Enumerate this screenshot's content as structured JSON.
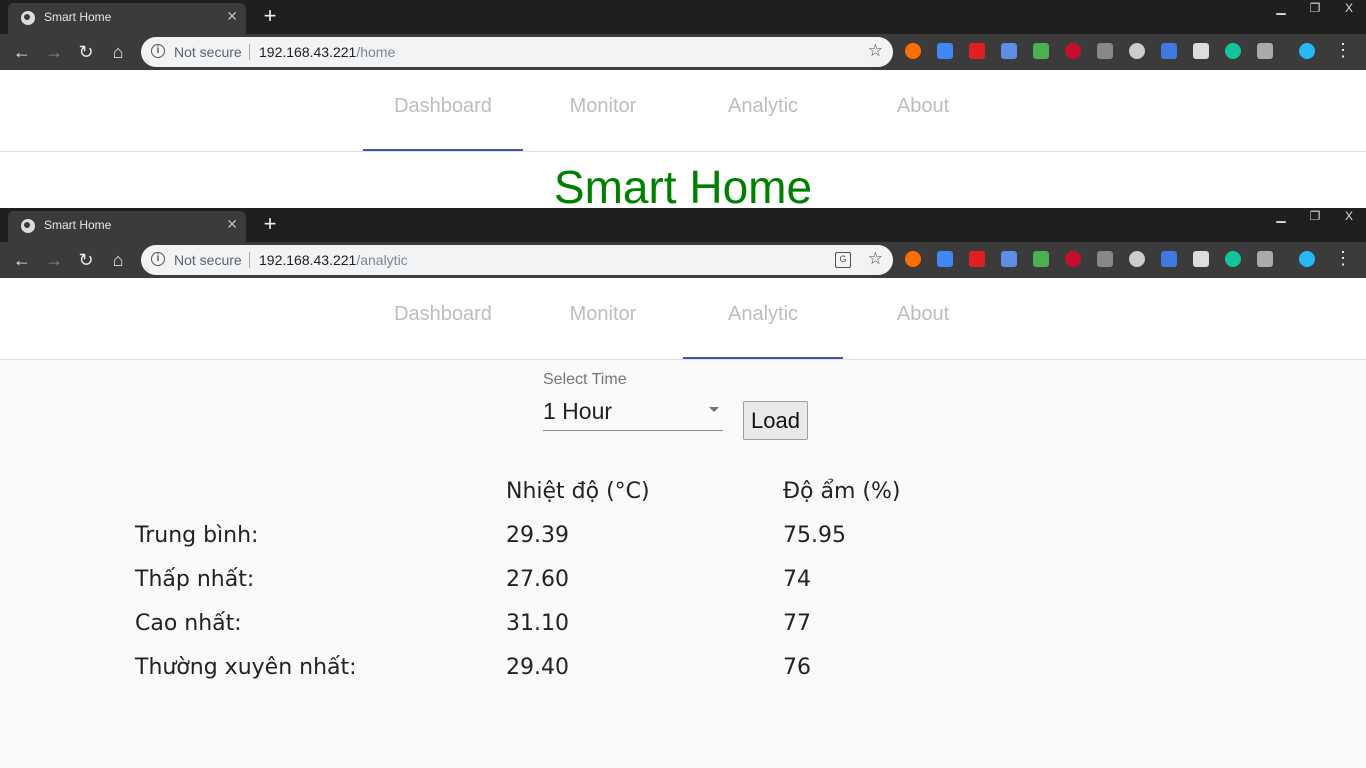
{
  "browser": {
    "close_glyph": "✕",
    "new_tab_glyph": "+",
    "minimize_glyph": "▁",
    "restore_glyph": "❐",
    "window_close_glyph": "X",
    "back_glyph": "←",
    "forward_glyph": "→",
    "reload_glyph": "↻",
    "home_glyph": "⌂",
    "star_glyph": "☆",
    "menu_glyph": "⋮",
    "info_glyph": "i",
    "not_secure": "Not secure"
  },
  "window1": {
    "tab_title": "Smart Home",
    "url_host": "192.168.43.221",
    "url_path": "/home",
    "page_title": "Smart Home"
  },
  "window2": {
    "tab_title": "Smart Home",
    "url_host": "192.168.43.221",
    "url_path": "/analytic"
  },
  "nav": {
    "tabs": [
      {
        "label": "Dashboard"
      },
      {
        "label": "Monitor"
      },
      {
        "label": "Analytic"
      },
      {
        "label": "About"
      }
    ]
  },
  "analytic": {
    "select_label": "Select Time",
    "select_value": "1 Hour",
    "load_button": "Load",
    "columns": [
      "Nhiệt độ (°C)",
      "Độ ẩm (%)"
    ],
    "rows": [
      {
        "label": "Trung bình:",
        "temp": "29.39",
        "humidity": "75.95"
      },
      {
        "label": "Thấp nhất:",
        "temp": "27.60",
        "humidity": "74"
      },
      {
        "label": "Cao nhất:",
        "temp": "31.10",
        "humidity": "77"
      },
      {
        "label": "Thường xuyên nhất:",
        "temp": "29.40",
        "humidity": "76"
      }
    ]
  },
  "extensions": [
    {
      "name": "infinity-ext-icon",
      "color": "#ff6f00"
    },
    {
      "name": "google-translate-ext-icon",
      "color": "#4285f4"
    },
    {
      "name": "adblock-hand-ext-icon",
      "color": "#e02020"
    },
    {
      "name": "grid-ext-icon",
      "color": "#5c8ee6"
    },
    {
      "name": "color-palette-ext-icon",
      "color": "#4caf50"
    },
    {
      "name": "abp-ext-icon",
      "color": "#c70d2c"
    },
    {
      "name": "pin-ext-icon",
      "color": "#888888"
    },
    {
      "name": "circle-ext-icon",
      "color": "#cccccc"
    },
    {
      "name": "screen-2d-ext-icon",
      "color": "#3d7be0"
    },
    {
      "name": "pen-ext-icon",
      "color": "#dddddd"
    },
    {
      "name": "grammarly-ext-icon",
      "color": "#15c39a"
    },
    {
      "name": "csharp-ext-icon",
      "color": "#aaaaaa"
    },
    {
      "name": "sync-ext-icon",
      "color": "#29b6f6"
    }
  ]
}
